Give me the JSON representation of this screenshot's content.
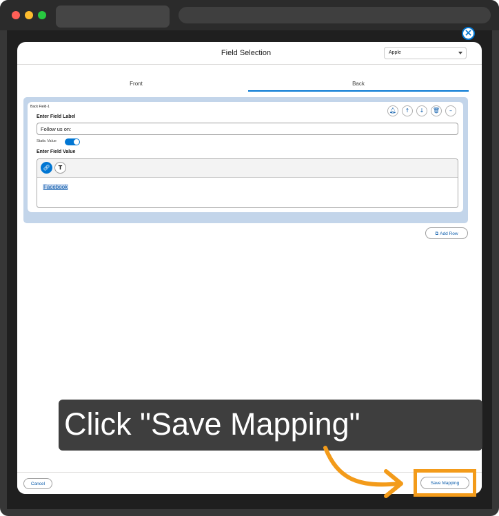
{
  "modal": {
    "title": "Field Selection",
    "select_value": "Apple",
    "tabs": [
      {
        "label": "Front",
        "active": false
      },
      {
        "label": "Back",
        "active": true
      }
    ]
  },
  "field": {
    "caption": "Back Field-1",
    "label_heading": "Enter Field Label",
    "label_value": "Follow us on:",
    "static_value_label": "Static Value",
    "static_value_on": true,
    "value_heading": "Enter Field Value",
    "value_link_text": "Facebook",
    "actions": [
      "bell-icon",
      "arrow-up-icon",
      "arrow-down-icon",
      "trash-icon",
      "more-icon"
    ]
  },
  "buttons": {
    "add_row": "Add Row",
    "cancel": "Cancel",
    "save_mapping": "Save Mapping"
  },
  "callout": {
    "text": "Click \"Save Mapping\""
  },
  "colors": {
    "accent": "#0176d3",
    "highlight": "#f39b1a",
    "panel": "#c3d5ea"
  }
}
